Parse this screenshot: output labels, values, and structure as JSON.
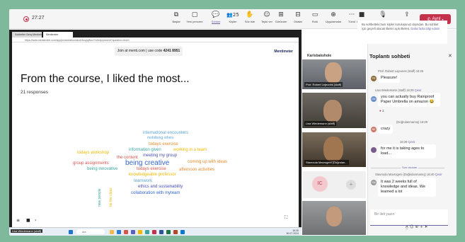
{
  "toolbar": {
    "timer": "27:27",
    "buttons": [
      {
        "label": "Başlat",
        "icon": "camera-record-icon",
        "glyph": "⧉"
      },
      {
        "label": "Yeni pencere",
        "icon": "new-window-icon",
        "glyph": "▢"
      },
      {
        "label": "Sohbet",
        "icon": "chat-icon",
        "glyph": "💬"
      },
      {
        "label": "Kişiler",
        "icon": "people-icon",
        "glyph": "👥",
        "badge": "25"
      },
      {
        "label": "Söz iste",
        "icon": "raise-hand-icon",
        "glyph": "✋"
      },
      {
        "label": "Tepki ver",
        "icon": "react-icon",
        "glyph": "☺"
      },
      {
        "label": "Görünüm",
        "icon": "view-icon",
        "glyph": "⊞"
      },
      {
        "label": "Odalar",
        "icon": "rooms-icon",
        "glyph": "⊟"
      },
      {
        "label": "Rolü",
        "icon": "role-icon",
        "glyph": "▭"
      },
      {
        "label": "Uygulamalar",
        "icon": "apps-icon",
        "glyph": "⊕"
      },
      {
        "label": "Tümü",
        "icon": "more-icon",
        "glyph": "···"
      },
      {
        "label": "Kamera",
        "icon": "camera-icon",
        "glyph": "■"
      },
      {
        "label": "Mikrofon",
        "icon": "microphone-icon",
        "glyph": "🎙"
      },
      {
        "label": "Paylaş",
        "icon": "share-icon",
        "glyph": "⇪"
      }
    ],
    "leave_label": "Ayrıl"
  },
  "browser": {
    "tabs": [
      "Sohbetler Genç Mentorluk...",
      "Mentimeter"
    ],
    "url": "https://www.mentimeter.com/app/presentation/alnd24wqhy8wx7m2kdp/present?question=rk4vh"
  },
  "slide": {
    "join_text": "Join at menti.com | use code",
    "code": "4241 8951",
    "brand": "Mentimeter",
    "title": "From the course, I liked the most...",
    "responses": "21 responses"
  },
  "wordcloud": [
    {
      "text": "international encounters",
      "color": "#5aa6d8",
      "size": 6
    },
    {
      "text": "mobilising others",
      "color": "#5aa6d8",
      "size": 5
    },
    {
      "text": "todays exercise",
      "color": "#e88b2e",
      "size": 6
    },
    {
      "text": "information given",
      "color": "#3aa6a0",
      "size": 6
    },
    {
      "text": "working in a team",
      "color": "#f0b800",
      "size": 6
    },
    {
      "text": "todays workshop",
      "color": "#f0b800",
      "size": 6
    },
    {
      "text": "meeting my group",
      "color": "#4a4fb3",
      "size": 6
    },
    {
      "text": "the content",
      "color": "#d9534f",
      "size": 6
    },
    {
      "text": "group assignments",
      "color": "#d9534f",
      "size": 6
    },
    {
      "text": "being creative",
      "color": "#3366cc",
      "size": 10
    },
    {
      "text": "coming up with ideas",
      "color": "#e88b2e",
      "size": 6
    },
    {
      "text": "being innovative",
      "color": "#3aa6a0",
      "size": 6
    },
    {
      "text": "todays exercise",
      "color": "#d9534f",
      "size": 6
    },
    {
      "text": "afternoon activities",
      "color": "#e88b2e",
      "size": 6
    },
    {
      "text": "knowledgeable professor",
      "color": "#f0b800",
      "size": 6
    },
    {
      "text": "teamwork",
      "color": "#5aa6d8",
      "size": 6
    },
    {
      "text": "ethics and sustainability",
      "color": "#4a4fb3",
      "size": 6
    },
    {
      "text": "collaboration with myteam",
      "color": "#3366cc",
      "size": 6
    },
    {
      "text": "new people",
      "color": "#3aa6a0",
      "size": 5
    },
    {
      "text": "be the class",
      "color": "#f0b800",
      "size": 5
    }
  ],
  "taskbar": {
    "presenter": "Lisa Wiedemann (staff)",
    "search": "Ara",
    "time": "16:30",
    "date": "30.07.2024"
  },
  "participants": [
    {
      "name": "Karlsbakshole",
      "type": "label"
    },
    {
      "name": "Prof. Robert Lejeunes (staff)",
      "type": "video"
    },
    {
      "name": "Lisa Wiedemann (staff)",
      "type": "video"
    },
    {
      "name": "Stavroula Mavrogeni (Doğrulan...",
      "type": "video"
    },
    {
      "initials": "IC",
      "type": "avatar"
    },
    {
      "name": "",
      "type": "video"
    }
  ],
  "chat": {
    "banner_text": "Bu sohbetteki bazı kişiler kuruluşunuz dışından. Bu sohbet için geçerli olacak ilkeler açık ilkeleri.",
    "banner_link": "Daha fazla bilgi edinin",
    "title": "Toplantı sohbeti",
    "messages": [
      {
        "author": "Prof. Robert Lejeunes (staff)",
        "time": "16:25",
        "text": "Pleasure!",
        "avatar": "PR",
        "avatar_color": "#8a6d3b"
      },
      {
        "author": "Lisa Wiedemann (staff)",
        "time": "16:29",
        "text": "you can actually buy Rainproof Paper Umbrella on amazon 😂",
        "avatar": "LW",
        "avatar_color": "#6b8fc9",
        "reply": "Çevir"
      },
      {
        "author": "(Doğrulanmamış)",
        "time": "16:29",
        "text": "crazy",
        "avatar": "NK",
        "avatar_color": "#c97b6b"
      },
      {
        "author": "",
        "time": "16:29",
        "text": "for me it is taking ages to load...",
        "avatar": "",
        "avatar_color": "#7a5c8a",
        "reply": "Çevir"
      },
      {
        "author": "Stavroula Mavrogeni (Doğrulanmamış)",
        "time": "16:40",
        "text": "It was 2 weeks full of knowledge and ideas. We learned a lot",
        "avatar": "SM",
        "avatar_color": "#9b9b9b",
        "reply": "Çevir"
      }
    ],
    "divider": "Son okunan",
    "reaction_count": "1",
    "input_placeholder": "Bir ileti yazın"
  }
}
